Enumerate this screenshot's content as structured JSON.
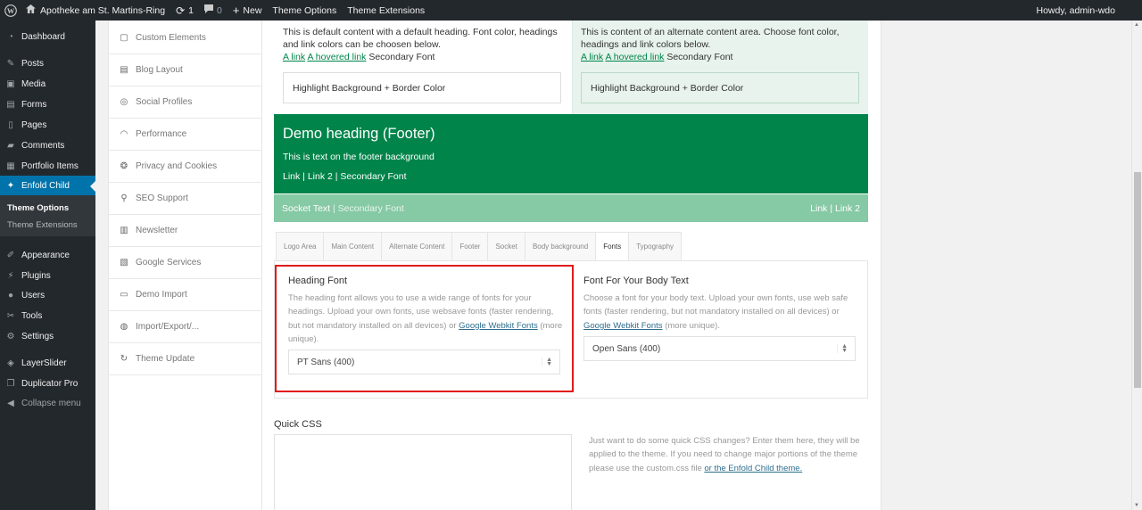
{
  "adminbar": {
    "site_name": "Apotheke am St. Martins-Ring",
    "updates_count": "1",
    "comments_count": "0",
    "new_label": "New",
    "theme_options": "Theme Options",
    "theme_extensions": "Theme Extensions",
    "howdy": "Howdy, admin-wdo"
  },
  "menu": {
    "items": [
      {
        "label": "Dashboard",
        "icon": "dashboard-icon"
      },
      {
        "label": "Posts",
        "icon": "pin-icon"
      },
      {
        "label": "Media",
        "icon": "media-icon"
      },
      {
        "label": "Forms",
        "icon": "forms-icon"
      },
      {
        "label": "Pages",
        "icon": "page-icon"
      },
      {
        "label": "Comments",
        "icon": "comment-icon"
      },
      {
        "label": "Portfolio Items",
        "icon": "portfolio-icon"
      },
      {
        "label": "Enfold Child",
        "icon": "enfold-icon"
      },
      {
        "label": "Appearance",
        "icon": "brush-icon"
      },
      {
        "label": "Plugins",
        "icon": "plug-icon"
      },
      {
        "label": "Users",
        "icon": "user-icon"
      },
      {
        "label": "Tools",
        "icon": "wrench-icon"
      },
      {
        "label": "Settings",
        "icon": "settings-icon"
      },
      {
        "label": "LayerSlider",
        "icon": "layers-icon"
      },
      {
        "label": "Duplicator Pro",
        "icon": "duplicate-icon"
      }
    ],
    "submenu": [
      "Theme Options",
      "Theme Extensions"
    ],
    "collapse": "Collapse menu"
  },
  "options_nav": [
    {
      "label": "Custom Elements",
      "icon": "elements-icon"
    },
    {
      "label": "Blog Layout",
      "icon": "blog-icon"
    },
    {
      "label": "Social Profiles",
      "icon": "social-icon"
    },
    {
      "label": "Performance",
      "icon": "gauge-icon"
    },
    {
      "label": "Privacy and Cookies",
      "icon": "cookie-icon"
    },
    {
      "label": "SEO Support",
      "icon": "seo-icon"
    },
    {
      "label": "Newsletter",
      "icon": "newsletter-icon"
    },
    {
      "label": "Google Services",
      "icon": "map-icon"
    },
    {
      "label": "Demo Import",
      "icon": "import-icon"
    },
    {
      "label": "Import/Export/...",
      "icon": "import-export-icon"
    },
    {
      "label": "Theme Update",
      "icon": "refresh-icon"
    }
  ],
  "demo": {
    "left_text": "This is default content with a default heading. Font color, headings and link colors can be choosen below.",
    "right_text": "This is content of an alternate content area. Choose font color, headings and link colors below.",
    "link": "A link",
    "hovered_link": "A hovered link",
    "secondary": "Secondary Font",
    "highlight": "Highlight Background + Border Color",
    "footer_heading": "Demo heading (Footer)",
    "footer_text": "This is text on the footer background",
    "footer_links": "Link | Link 2 | Secondary Font",
    "socket_text": "Socket Text",
    "socket_secondary": "| Secondary Font",
    "socket_links": "Link | Link 2"
  },
  "tabs": [
    "Logo Area",
    "Main Content",
    "Alternate Content",
    "Footer",
    "Socket",
    "Body background",
    "Fonts",
    "Typography"
  ],
  "heading_font": {
    "title": "Heading Font",
    "desc_before": "The heading font allows you to use a wide range of fonts for your headings. Upload your own fonts, use websave fonts (faster rendering, but not mandatory installed on all devices) or",
    "link": "Google Webkit Fonts",
    "desc_after": "(more unique).",
    "value": "PT Sans (400)"
  },
  "body_font": {
    "title": "Font For Your Body Text",
    "desc_before": "Choose a font for your body text. Upload your own fonts, use web safe fonts (faster rendering, but not mandatory installed on all devices) or",
    "link": "Google Webkit Fonts",
    "desc_after": "(more unique).",
    "value": "Open Sans (400)"
  },
  "quick_css": {
    "title": "Quick CSS",
    "desc": "Just want to do some quick CSS changes? Enter them here, they will be applied to the theme. If you need to change major portions of the theme please use the custom.css file",
    "link": "or the Enfold Child theme."
  },
  "colors": {
    "accent": "#0073aa",
    "footer_green": "#00844a",
    "socket_green": "#86c9a5",
    "highlight_red": "#e01b1b"
  }
}
